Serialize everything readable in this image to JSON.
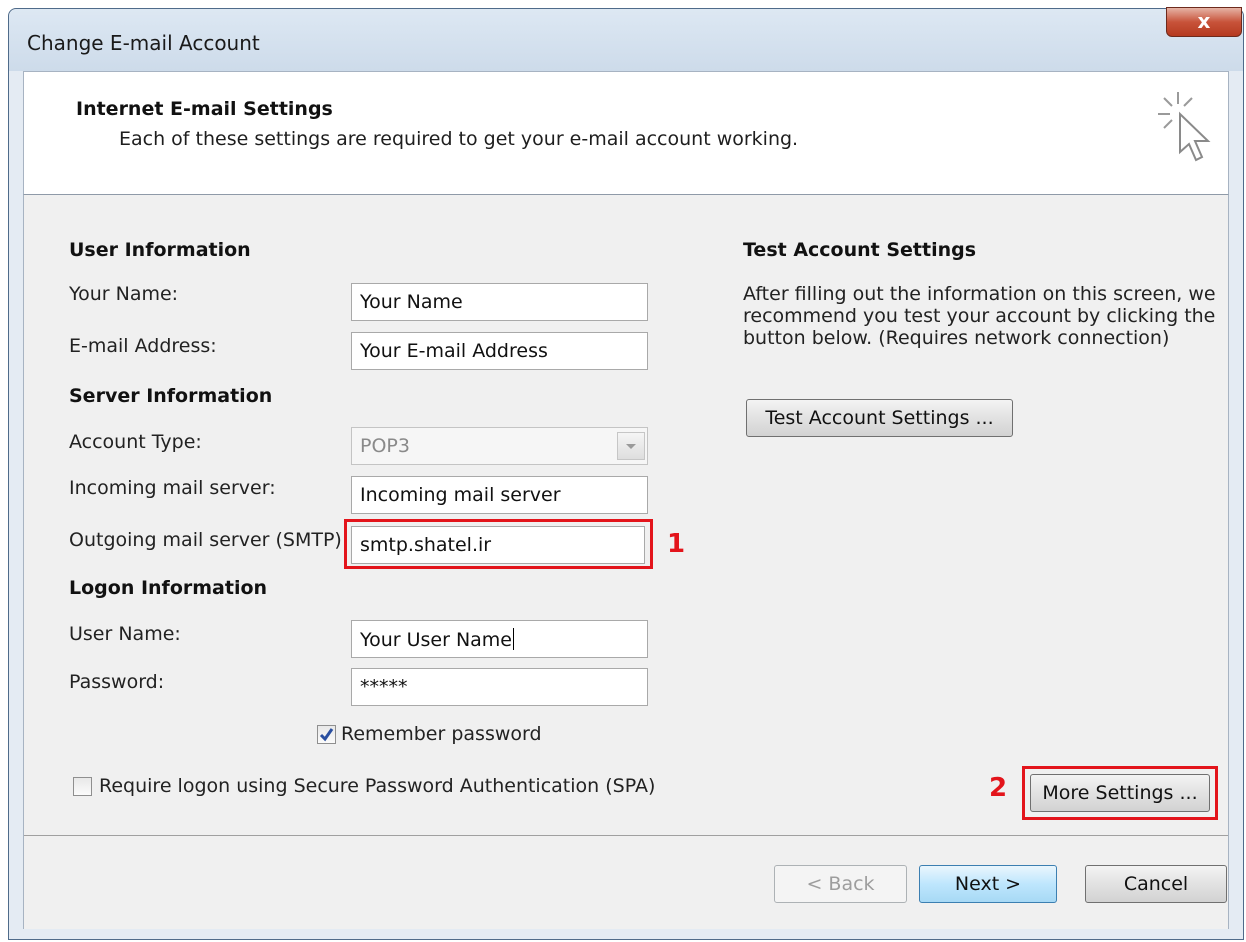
{
  "window": {
    "title": "Change E-mail Account",
    "close_glyph": "x"
  },
  "header": {
    "title": "Internet E-mail Settings",
    "description": "Each of these settings are required to get your e-mail account working.",
    "icon": "wizard-cursor-icon"
  },
  "user_info": {
    "heading": "User Information",
    "name_label": "Your Name:",
    "name_value": "Your Name",
    "email_label": "E-mail Address:",
    "email_value": "Your E-mail Address"
  },
  "server_info": {
    "heading": "Server Information",
    "account_type_label": "Account Type:",
    "account_type_value": "POP3",
    "incoming_label": "Incoming mail server:",
    "incoming_value": "Incoming mail server",
    "outgoing_label": "Outgoing mail server (SMTP):",
    "outgoing_value": "smtp.shatel.ir"
  },
  "logon_info": {
    "heading": "Logon Information",
    "username_label": "User Name:",
    "username_value": "Your User Name",
    "password_label": "Password:",
    "password_value": "*****",
    "remember_label": "Remember password",
    "remember_checked": true,
    "spa_label": "Require logon using Secure Password Authentication (SPA)",
    "spa_checked": false
  },
  "test_settings": {
    "heading": "Test Account Settings",
    "description": "After filling out the information on this screen, we recommend you test your account by clicking the button below. (Requires network connection)",
    "button_label": "Test Account Settings ..."
  },
  "more_settings": {
    "button_label": "More Settings ..."
  },
  "annotations": {
    "marker_1": "1",
    "marker_2": "2",
    "color": "#e3141b"
  },
  "footer": {
    "back_label": "< Back",
    "next_label": "Next >",
    "cancel_label": "Cancel"
  }
}
